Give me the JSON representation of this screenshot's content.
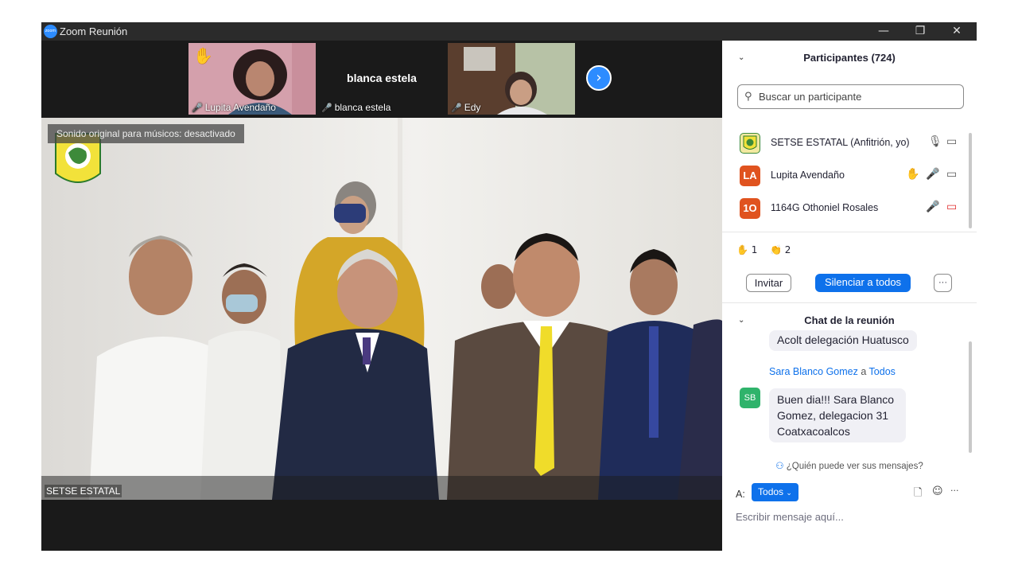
{
  "window": {
    "title": "Zoom Reunión",
    "app_icon_text": "zoom",
    "minimize_icon": "—",
    "restore_icon": "❐",
    "close_icon": "✕"
  },
  "gallery": {
    "thumbnails": [
      {
        "name": "Lupita Avendaño",
        "reaction": "✋"
      },
      {
        "name": "blanca estela",
        "center_text": "blanca estela"
      },
      {
        "name": "Edy"
      }
    ],
    "mute_icon": "🎤",
    "next_icon": "›"
  },
  "main_video": {
    "banner": "Sonido original para músicos: desactivado",
    "speaker_name": "SETSE ESTATAL"
  },
  "participants": {
    "title": "Participantes (724)",
    "collapse_icon": "⌄",
    "search_placeholder": "Buscar un participante",
    "search_icon": "⚲",
    "list": [
      {
        "avatar": "",
        "name": "SETSE ESTATAL (Anfitrión, yo)",
        "color": "#f2e9a0"
      },
      {
        "avatar": "LA",
        "name": "Lupita Avendaño",
        "color": "#e0531f"
      },
      {
        "avatar": "1O",
        "name": "1164G Othoniel Rosales",
        "color": "#e0531f"
      }
    ],
    "reactions": [
      {
        "icon": "✋",
        "count": "1"
      },
      {
        "icon": "👏",
        "count": "2"
      }
    ],
    "invite_label": "Invitar",
    "mute_all_label": "Silenciar a todos",
    "more_label": "···"
  },
  "chat": {
    "title": "Chat de la reunión",
    "previous_message": "Acolt delegación Huatusco",
    "sender": "Sara Blanco Gomez",
    "sender_connector": "a",
    "recipient": "Todos",
    "sender_initials": "SB",
    "message_lines": [
      "Buen dia!!! Sara Blanco",
      "Gomez, delegacion 31",
      "Coatxacoalcos"
    ],
    "who_can_see": "¿Quién puede ver sus mensajes?",
    "to_label": "A:",
    "to_value": "Todos",
    "compose_placeholder": "Escribir mensaje aquí...",
    "file_icon": "🗋",
    "emoji_icon": "☺",
    "more_icon": "···"
  },
  "colors": {
    "accent": "#0e71eb",
    "titlebar": "#2b2b2b",
    "video_bg": "#1a1a1a",
    "mute_red": "#e02828"
  }
}
